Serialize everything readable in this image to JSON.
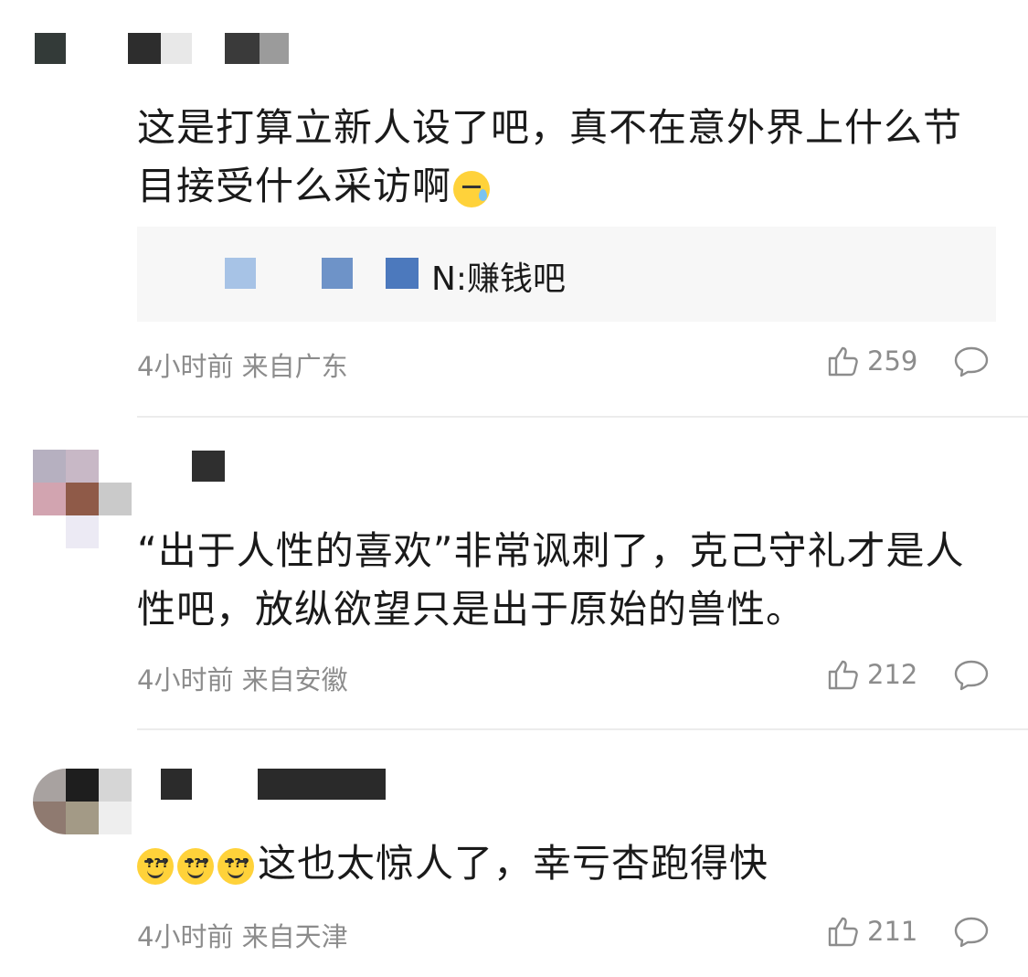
{
  "comments": [
    {
      "text": "这是打算立新人设了吧，真不在意外界上什么节目接受什么采访啊",
      "quote": "N:赚钱吧",
      "time": "4小时前",
      "location": "来自广东",
      "likes": "259"
    },
    {
      "text": "“出于人性的喜欢”非常讽刺了，克己守礼才是人性吧，放纵欲望只是出于原始的兽性。",
      "time": "4小时前",
      "location": "来自安徽",
      "likes": "212"
    },
    {
      "emoji_mark": "???",
      "text": "这也太惊人了，幸亏杏跑得快",
      "time": "4小时前",
      "location": "来自天津",
      "likes": "211"
    }
  ],
  "colors": {
    "meta": "#8c8c8c",
    "text": "#1a1a1a",
    "quote_bg": "#f7f7f7",
    "divider": "#ececec"
  },
  "icons": {
    "like": "thumbs-up-icon",
    "reply": "speech-bubble-icon",
    "emoji_sad": "sweat-emoji-icon",
    "emoji_dizzy": "dizzy-emoji-icon"
  }
}
